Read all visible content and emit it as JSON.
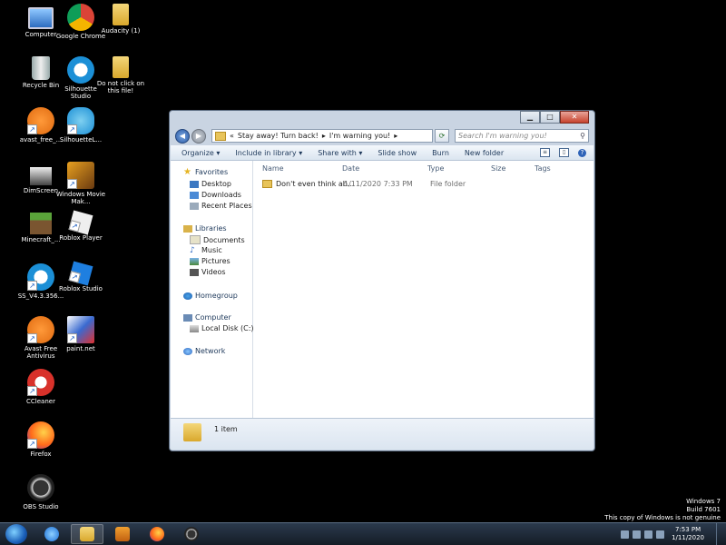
{
  "desktop": {
    "icons": [
      {
        "label": "Computer"
      },
      {
        "label": "Google Chrome"
      },
      {
        "label": "Audacity (1)"
      },
      {
        "label": "Recycle Bin"
      },
      {
        "label": "Silhouette Studio"
      },
      {
        "label": "Do not click on this file!"
      },
      {
        "label": "avast_free_..."
      },
      {
        "label": "SilhouetteL..."
      },
      {
        "label": "DimScreen"
      },
      {
        "label": "Windows Movie Mak..."
      },
      {
        "label": "Minecraft_..."
      },
      {
        "label": "Roblox Player"
      },
      {
        "label": "SS_V4.3.356..."
      },
      {
        "label": "Roblox Studio"
      },
      {
        "label": "Avast Free Antivirus"
      },
      {
        "label": "paint.net"
      },
      {
        "label": "CCleaner"
      },
      {
        "label": "Firefox"
      },
      {
        "label": "OBS Studio"
      }
    ]
  },
  "explorer": {
    "address": {
      "prefix": "«",
      "part1": "Stay away! Turn back!",
      "sep": "▸",
      "part2": "I'm warning you!",
      "sep2": "▸"
    },
    "search_placeholder": "Search I'm warning you!",
    "toolbar": {
      "organize": "Organize ▾",
      "include": "Include in library ▾",
      "share": "Share with ▾",
      "slideshow": "Slide show",
      "burn": "Burn",
      "newfolder": "New folder"
    },
    "nav": {
      "favorites": "Favorites",
      "desktop": "Desktop",
      "downloads": "Downloads",
      "recent": "Recent Places",
      "libraries": "Libraries",
      "documents": "Documents",
      "music": "Music",
      "pictures": "Pictures",
      "videos": "Videos",
      "homegroup": "Homegroup",
      "computer": "Computer",
      "localdisk": "Local Disk (C:)",
      "network": "Network"
    },
    "columns": {
      "name": "Name",
      "date": "Date",
      "type": "Type",
      "size": "Size",
      "tags": "Tags"
    },
    "files": [
      {
        "name": "Don't even think ab...",
        "date": "1/11/2020 7:33 PM",
        "type": "File folder"
      }
    ],
    "status": "1 item"
  },
  "watermark": {
    "line1": "Windows 7",
    "line2": "Build 7601",
    "line3": "This copy of Windows is not genuine"
  },
  "clock": {
    "time": "7:53 PM",
    "date": "1/11/2020"
  },
  "colors": {
    "accent": "#1e395b",
    "folder": "#e8c45a"
  }
}
